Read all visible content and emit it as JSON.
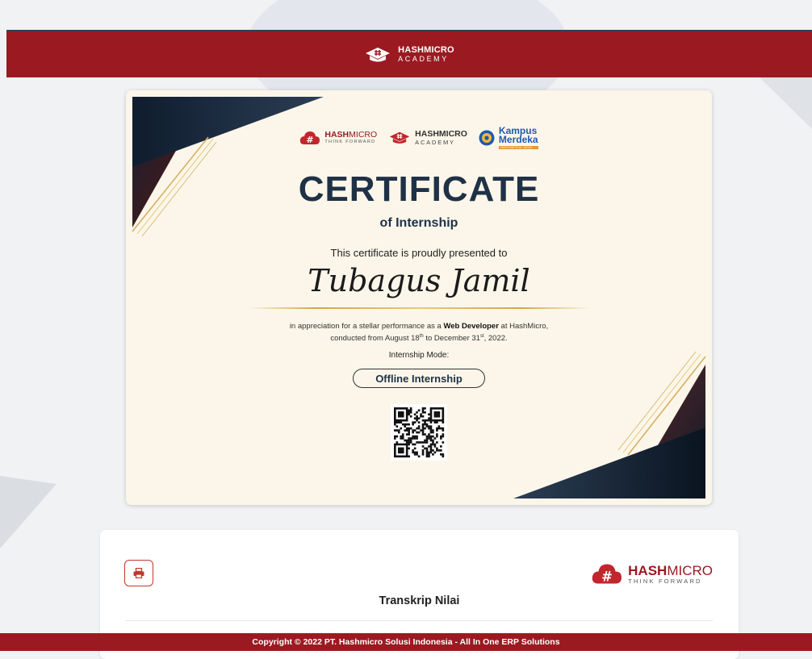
{
  "header": {
    "brand_line1": "HASHMICRO",
    "brand_line2": "ACADEMY"
  },
  "certificate": {
    "logos": {
      "hashmicro": {
        "line1_bold": "HASH",
        "line1_thin": "MICRO",
        "line2": "THINK FORWARD"
      },
      "academy": {
        "line1": "HASHMICRO",
        "line2": "ACADEMY"
      },
      "kampus": {
        "line1": "Kampus",
        "line2": "Merdeka",
        "line3": "INDONESIA JAYA"
      }
    },
    "title": "CERTIFICATE",
    "subtitle": "of Internship",
    "presented_text": "This certificate is proudly presented to",
    "recipient_name": "Tubagus Jamil",
    "appreciation_pre": "in appreciation for a stellar performance as a ",
    "role": "Web Developer",
    "appreciation_post": " at HashMicro,",
    "period_pre": "conducted from August 18",
    "period_sup1": "th",
    "period_mid": " to December 31",
    "period_sup2": "st",
    "period_post": ", 2022.",
    "mode_label": "Internship Mode:",
    "mode_value": "Offline Internship"
  },
  "panel": {
    "logo_bold": "HASH",
    "logo_thin": "MICRO",
    "logo_tagline": "THINK FORWARD",
    "title": "Transkrip Nilai",
    "print_icon": "print-icon"
  },
  "footer": {
    "copyright": "Copyright © 2022 PT. Hashmicro Solusi Indonesia - All In One ERP Solutions"
  },
  "colors": {
    "brand_red": "#9b1a21",
    "navy": "#1f3146",
    "gold": "#d4a844",
    "cert_bg": "#fbf6e9"
  }
}
